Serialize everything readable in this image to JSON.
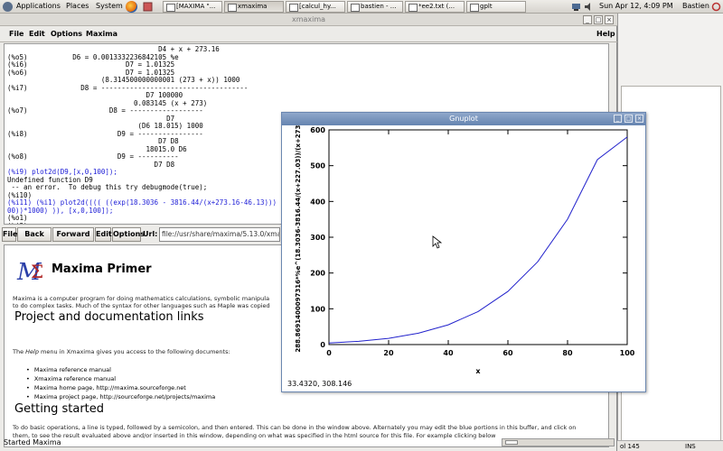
{
  "panel": {
    "menus": [
      "Applications",
      "Places",
      "System"
    ],
    "tasks": [
      {
        "label": "[MAXIMA \"...",
        "active": false
      },
      {
        "label": "xmaxima",
        "active": true
      },
      {
        "label": "[calcul_hy...",
        "active": false
      },
      {
        "label": "bastien - ...",
        "active": false
      },
      {
        "label": "*ee2.txt (...",
        "active": false
      },
      {
        "label": "gplt",
        "active": false
      }
    ],
    "datetime": "Sun Apr 12,  4:09 PM",
    "user": "Bastien"
  },
  "xmaxima": {
    "title": "xmaxima",
    "menu": {
      "file": "File",
      "edit": "Edit",
      "options": "Options",
      "maxima": "Maxima",
      "help": "Help"
    },
    "console_lines": [
      {
        "text": "                                     D4 + x + 273.16",
        "color": "black"
      },
      {
        "text": "(%o5)           D6 = 0.0013332236842105 %e",
        "color": "black"
      },
      {
        "text": "(%i6)                        D7 = 1.01325",
        "color": "black"
      },
      {
        "text": "(%o6)                        D7 = 1.01325",
        "color": "black"
      },
      {
        "text": "                       (8.314500000000001 (273 + x)) 1000",
        "color": "black"
      },
      {
        "text": "(%i7)             D8 = ------------------------------------",
        "color": "black"
      },
      {
        "text": "                                  D7 100000",
        "color": "black"
      },
      {
        "text": "                               0.083145 (x + 273)",
        "color": "black"
      },
      {
        "text": "(%o7)                    D8 = ------------------",
        "color": "black"
      },
      {
        "text": "                                       D7",
        "color": "black"
      },
      {
        "text": "                                (D6 18.015) 1000",
        "color": "black"
      },
      {
        "text": "(%i8)                      D9 = ----------------",
        "color": "black"
      },
      {
        "text": "                                     D7 D8",
        "color": "black"
      },
      {
        "text": "                                  18015.0 D6",
        "color": "black"
      },
      {
        "text": "(%o8)                      D9 = ----------",
        "color": "black"
      },
      {
        "text": "                                    D7 D8",
        "color": "black"
      },
      {
        "text": "(%i9) plot2d(D9,[x,0,100]);",
        "color": "blue"
      },
      {
        "text": "Undefined function D9",
        "color": "black"
      },
      {
        "text": " -- an error.  To debug this try debugmode(true);",
        "color": "black"
      },
      {
        "text": "(%i10)",
        "color": "black"
      },
      {
        "text": "(%i11) (%i1) plot2d(((( ((exp(18.3036 - 3816.44/(x+273.16-46.13))) * (",
        "color": "blue"
      },
      {
        "text": "00))*1000) )), [x,0,100]);",
        "color": "blue"
      },
      {
        "text": "(%o1)",
        "color": "black"
      },
      {
        "text": "(%i2)",
        "color": "black"
      }
    ],
    "browser": {
      "file": "File",
      "back": "Back",
      "forward": "Forward",
      "edit": "Edit",
      "options": "Options",
      "url_label": "Url:",
      "url": "file://usr/share/maxima/5.13.0/xmaxima/intro.html"
    },
    "help": {
      "logo_alt": "Maxima logo",
      "title": "Maxima Primer",
      "intro1": "Maxima is a computer program for doing mathematics calculations, symbolic manipula",
      "intro2": "to do complex tasks. Much of the syntax for other languages such as Maple was copied",
      "heading1": "Project and documentation links",
      "links_intro_pre": "The ",
      "links_intro_help": "Help",
      "links_intro_post": " menu in Xmaxima gives you access to the following documents:",
      "links": [
        "Maxima reference manual",
        "Xmaxima reference manual",
        "Maxima home page, http://maxima.sourceforge.net",
        "Maxima project page, http://sourceforge.net/projects/maxima"
      ],
      "heading2": "Getting started",
      "gs1": "To do basic operations, a line is typed, followed by a semicolon, and then entered. This can be done in the window above. Alternately you may edit the blue portions in this buffer, and click on",
      "gs2": "them, to see the result evaluated above and/or inserted in this window, depending on what was specified in the html source for this file. For example clicking below"
    },
    "status": "Started Maxima"
  },
  "right_window": {
    "status_left": "ol 145",
    "status_right": "INS"
  },
  "gnuplot": {
    "title": "Gnuplot",
    "coords": "33.4320,  308.146",
    "chart_data": {
      "type": "line",
      "title": "",
      "xlabel": "x",
      "ylabel": "288.8691400097316*%e^(18.3036-3816.44/(x+227.03))/(x+273)",
      "xlim": [
        0,
        100
      ],
      "ylim": [
        0,
        600
      ],
      "xticks": [
        0,
        20,
        40,
        60,
        80,
        100
      ],
      "yticks": [
        0,
        100,
        200,
        300,
        400,
        500,
        600
      ],
      "color": "#2222cc",
      "series": [
        {
          "x": [
            0,
            10,
            20,
            30,
            40,
            50,
            60,
            70,
            80,
            90,
            100
          ],
          "values": [
            4.6,
            9.2,
            17.5,
            31.7,
            55.1,
            92.2,
            148.5,
            231.5,
            350.5,
            516.7,
            580
          ]
        }
      ]
    }
  }
}
